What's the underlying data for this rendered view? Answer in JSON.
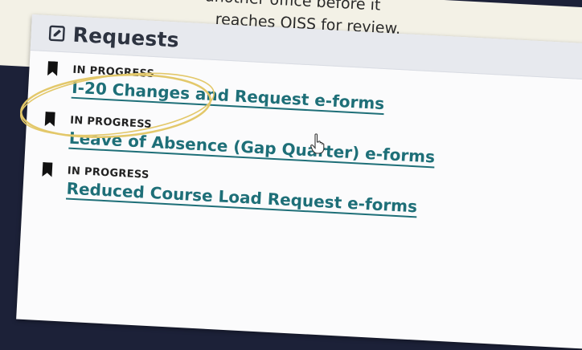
{
  "background_text": {
    "line1": "another office before it",
    "line2": "reaches OISS for review."
  },
  "card": {
    "title": "Requests",
    "icon": "edit-icon"
  },
  "requests": [
    {
      "status": "IN PROGRESS",
      "label": "I-20 Changes and Request e-forms"
    },
    {
      "status": "IN PROGRESS",
      "label": "Leave of Absence (Gap Quarter) e-forms"
    },
    {
      "status": "IN PROGRESS",
      "label": "Reduced Course Load Request e-forms"
    }
  ],
  "colors": {
    "link": "#1e6f78",
    "highlight": "#e3c86a",
    "background": "#1c2138"
  }
}
